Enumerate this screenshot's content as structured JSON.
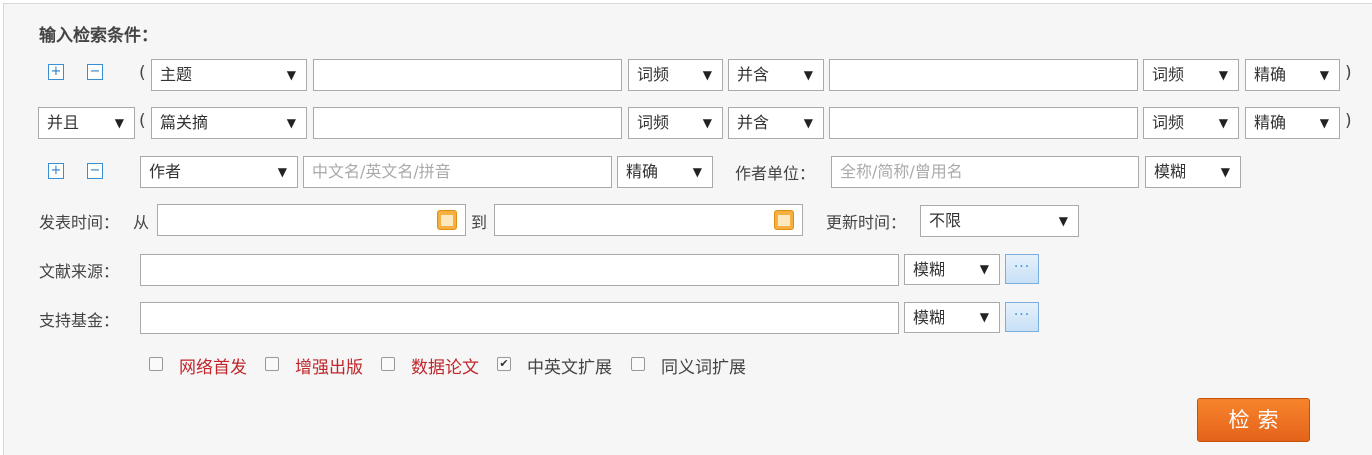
{
  "title": "输入检索条件：",
  "rows": {
    "r1": {
      "field": "主题",
      "freq1": "词频",
      "rel": "并含",
      "freq2": "词频",
      "match": "精确"
    },
    "r2": {
      "logic": "并且",
      "field": "篇关摘",
      "freq1": "词频",
      "rel": "并含",
      "freq2": "词频",
      "match": "精确"
    },
    "r3": {
      "field": "作者",
      "placeholder": "中文名/英文名/拼音",
      "match": "精确",
      "unit_label": "作者单位：",
      "unit_placeholder": "全称/简称/曾用名",
      "unit_match": "模糊"
    }
  },
  "date": {
    "label": "发表时间：",
    "from": "从",
    "to": "到",
    "update_label": "更新时间：",
    "update_value": "不限"
  },
  "source": {
    "label": "文献来源：",
    "match": "模糊"
  },
  "fund": {
    "label": "支持基金：",
    "match": "模糊"
  },
  "options": [
    {
      "label": "网络首发",
      "checked": false
    },
    {
      "label": "增强出版",
      "checked": false
    },
    {
      "label": "数据论文",
      "checked": false
    },
    {
      "label": "中英文扩展",
      "checked": true
    },
    {
      "label": "同义词扩展",
      "checked": false
    }
  ],
  "symbols": {
    "plus": "+",
    "minus": "−",
    "open": "(",
    "close": ")",
    "arrow": "▼",
    "dots": "···",
    "check": "✔"
  },
  "search_button": "检索",
  "colors": {
    "accent": "#e8691f",
    "link_red": "#c0262b",
    "icon_blue": "#3a8fd4"
  }
}
